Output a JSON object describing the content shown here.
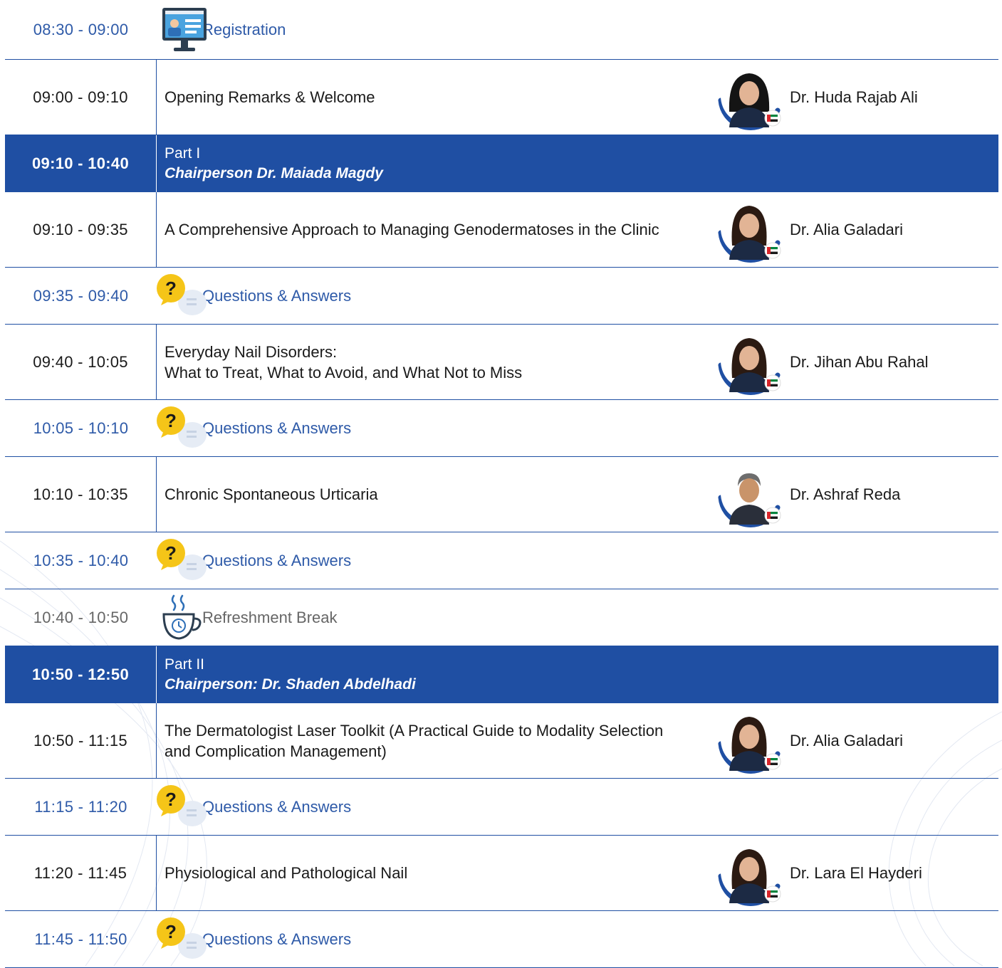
{
  "registration": {
    "time": "08:30 - 09:00",
    "label": "Registration",
    "icon": "computer-registration-icon"
  },
  "items": [
    {
      "kind": "talk",
      "time": "09:00 - 09:10",
      "lines": [
        "Opening Remarks & Welcome"
      ],
      "speaker": "Dr. Huda Rajab Ali",
      "photo": "speaker-photo-hijab"
    },
    {
      "kind": "part",
      "time": "09:10 - 10:40",
      "part": "Part I",
      "chair": "Chairperson Dr. Maiada Magdy"
    },
    {
      "kind": "talk",
      "time": "09:10 - 09:35",
      "lines": [
        "A Comprehensive Approach to Managing Genodermatoses in the Clinic"
      ],
      "speaker": "Dr. Alia Galadari",
      "photo": "speaker-photo-woman"
    },
    {
      "kind": "qa",
      "time": "09:35 - 09:40",
      "label": "Questions & Answers"
    },
    {
      "kind": "talk",
      "time": "09:40 - 10:05",
      "lines": [
        "Everyday Nail Disorders:",
        "What to Treat, What to Avoid, and What Not to Miss"
      ],
      "speaker": "Dr. Jihan Abu Rahal",
      "photo": "speaker-photo-woman"
    },
    {
      "kind": "qa",
      "time": "10:05 - 10:10",
      "label": "Questions & Answers"
    },
    {
      "kind": "talk",
      "time": "10:10 - 10:35",
      "lines": [
        "Chronic Spontaneous Urticaria"
      ],
      "speaker": "Dr. Ashraf Reda",
      "photo": "speaker-photo-man"
    },
    {
      "kind": "qa",
      "time": "10:35 - 10:40",
      "label": "Questions & Answers"
    },
    {
      "kind": "break",
      "time": "10:40 - 10:50",
      "label": "Refreshment Break"
    },
    {
      "kind": "part",
      "time": "10:50 - 12:50",
      "part": "Part II",
      "chair": "Chairperson: Dr. Shaden Abdelhadi"
    },
    {
      "kind": "talk",
      "time": "10:50 - 11:15",
      "lines": [
        "The Dermatologist Laser Toolkit (A Practical Guide to Modality Selection",
        "and Complication Management)"
      ],
      "speaker": "Dr. Alia Galadari",
      "photo": "speaker-photo-woman"
    },
    {
      "kind": "qa",
      "time": "11:15 - 11:20",
      "label": "Questions & Answers"
    },
    {
      "kind": "talk",
      "time": "11:20 - 11:45",
      "lines": [
        "Physiological and Pathological Nail"
      ],
      "speaker": "Dr. Lara El Hayderi",
      "photo": "speaker-photo-woman"
    },
    {
      "kind": "qa",
      "time": "11:45 - 11:50",
      "label": "Questions & Answers"
    }
  ],
  "colors": {
    "primary": "#1f4fa3",
    "qa_bubble": "#f5c518",
    "text": "#1a1a1a",
    "flag_red": "#d7262b",
    "flag_green": "#00843d"
  }
}
